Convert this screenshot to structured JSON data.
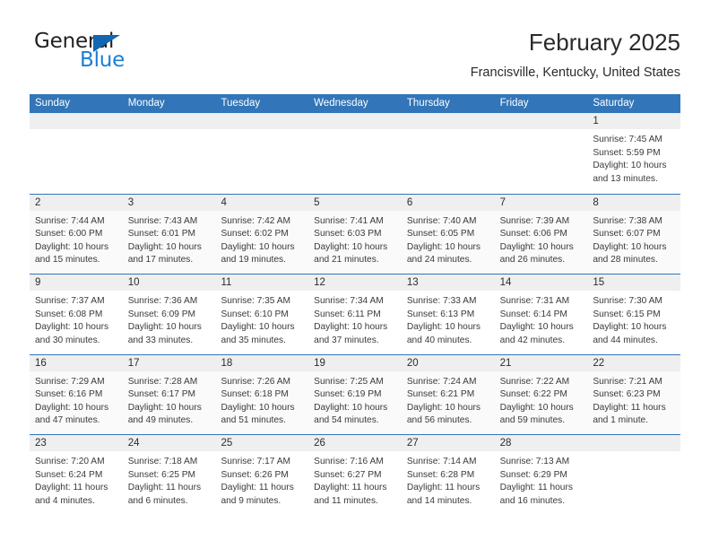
{
  "brand": {
    "name_top": "General",
    "name_bottom": "Blue",
    "accent_color": "#1167b1",
    "blue_text_color": "#1b7fd4"
  },
  "header": {
    "title": "February 2025",
    "subtitle": "Francisville, Kentucky, United States"
  },
  "theme": {
    "header_blue": "#3275b8",
    "day_band_gray": "#efefef",
    "row_shade": "#fafafa"
  },
  "weekdays": [
    "Sunday",
    "Monday",
    "Tuesday",
    "Wednesday",
    "Thursday",
    "Friday",
    "Saturday"
  ],
  "weeks": [
    {
      "shaded": false,
      "days": [
        {
          "number": "",
          "empty": true,
          "sunrise": "",
          "sunset": "",
          "daylight_line1": "",
          "daylight_line2": ""
        },
        {
          "number": "",
          "empty": true,
          "sunrise": "",
          "sunset": "",
          "daylight_line1": "",
          "daylight_line2": ""
        },
        {
          "number": "",
          "empty": true,
          "sunrise": "",
          "sunset": "",
          "daylight_line1": "",
          "daylight_line2": ""
        },
        {
          "number": "",
          "empty": true,
          "sunrise": "",
          "sunset": "",
          "daylight_line1": "",
          "daylight_line2": ""
        },
        {
          "number": "",
          "empty": true,
          "sunrise": "",
          "sunset": "",
          "daylight_line1": "",
          "daylight_line2": ""
        },
        {
          "number": "",
          "empty": true,
          "sunrise": "",
          "sunset": "",
          "daylight_line1": "",
          "daylight_line2": ""
        },
        {
          "number": "1",
          "empty": false,
          "sunrise": "Sunrise: 7:45 AM",
          "sunset": "Sunset: 5:59 PM",
          "daylight_line1": "Daylight: 10 hours",
          "daylight_line2": "and 13 minutes."
        }
      ]
    },
    {
      "shaded": true,
      "days": [
        {
          "number": "2",
          "empty": false,
          "sunrise": "Sunrise: 7:44 AM",
          "sunset": "Sunset: 6:00 PM",
          "daylight_line1": "Daylight: 10 hours",
          "daylight_line2": "and 15 minutes."
        },
        {
          "number": "3",
          "empty": false,
          "sunrise": "Sunrise: 7:43 AM",
          "sunset": "Sunset: 6:01 PM",
          "daylight_line1": "Daylight: 10 hours",
          "daylight_line2": "and 17 minutes."
        },
        {
          "number": "4",
          "empty": false,
          "sunrise": "Sunrise: 7:42 AM",
          "sunset": "Sunset: 6:02 PM",
          "daylight_line1": "Daylight: 10 hours",
          "daylight_line2": "and 19 minutes."
        },
        {
          "number": "5",
          "empty": false,
          "sunrise": "Sunrise: 7:41 AM",
          "sunset": "Sunset: 6:03 PM",
          "daylight_line1": "Daylight: 10 hours",
          "daylight_line2": "and 21 minutes."
        },
        {
          "number": "6",
          "empty": false,
          "sunrise": "Sunrise: 7:40 AM",
          "sunset": "Sunset: 6:05 PM",
          "daylight_line1": "Daylight: 10 hours",
          "daylight_line2": "and 24 minutes."
        },
        {
          "number": "7",
          "empty": false,
          "sunrise": "Sunrise: 7:39 AM",
          "sunset": "Sunset: 6:06 PM",
          "daylight_line1": "Daylight: 10 hours",
          "daylight_line2": "and 26 minutes."
        },
        {
          "number": "8",
          "empty": false,
          "sunrise": "Sunrise: 7:38 AM",
          "sunset": "Sunset: 6:07 PM",
          "daylight_line1": "Daylight: 10 hours",
          "daylight_line2": "and 28 minutes."
        }
      ]
    },
    {
      "shaded": false,
      "days": [
        {
          "number": "9",
          "empty": false,
          "sunrise": "Sunrise: 7:37 AM",
          "sunset": "Sunset: 6:08 PM",
          "daylight_line1": "Daylight: 10 hours",
          "daylight_line2": "and 30 minutes."
        },
        {
          "number": "10",
          "empty": false,
          "sunrise": "Sunrise: 7:36 AM",
          "sunset": "Sunset: 6:09 PM",
          "daylight_line1": "Daylight: 10 hours",
          "daylight_line2": "and 33 minutes."
        },
        {
          "number": "11",
          "empty": false,
          "sunrise": "Sunrise: 7:35 AM",
          "sunset": "Sunset: 6:10 PM",
          "daylight_line1": "Daylight: 10 hours",
          "daylight_line2": "and 35 minutes."
        },
        {
          "number": "12",
          "empty": false,
          "sunrise": "Sunrise: 7:34 AM",
          "sunset": "Sunset: 6:11 PM",
          "daylight_line1": "Daylight: 10 hours",
          "daylight_line2": "and 37 minutes."
        },
        {
          "number": "13",
          "empty": false,
          "sunrise": "Sunrise: 7:33 AM",
          "sunset": "Sunset: 6:13 PM",
          "daylight_line1": "Daylight: 10 hours",
          "daylight_line2": "and 40 minutes."
        },
        {
          "number": "14",
          "empty": false,
          "sunrise": "Sunrise: 7:31 AM",
          "sunset": "Sunset: 6:14 PM",
          "daylight_line1": "Daylight: 10 hours",
          "daylight_line2": "and 42 minutes."
        },
        {
          "number": "15",
          "empty": false,
          "sunrise": "Sunrise: 7:30 AM",
          "sunset": "Sunset: 6:15 PM",
          "daylight_line1": "Daylight: 10 hours",
          "daylight_line2": "and 44 minutes."
        }
      ]
    },
    {
      "shaded": true,
      "days": [
        {
          "number": "16",
          "empty": false,
          "sunrise": "Sunrise: 7:29 AM",
          "sunset": "Sunset: 6:16 PM",
          "daylight_line1": "Daylight: 10 hours",
          "daylight_line2": "and 47 minutes."
        },
        {
          "number": "17",
          "empty": false,
          "sunrise": "Sunrise: 7:28 AM",
          "sunset": "Sunset: 6:17 PM",
          "daylight_line1": "Daylight: 10 hours",
          "daylight_line2": "and 49 minutes."
        },
        {
          "number": "18",
          "empty": false,
          "sunrise": "Sunrise: 7:26 AM",
          "sunset": "Sunset: 6:18 PM",
          "daylight_line1": "Daylight: 10 hours",
          "daylight_line2": "and 51 minutes."
        },
        {
          "number": "19",
          "empty": false,
          "sunrise": "Sunrise: 7:25 AM",
          "sunset": "Sunset: 6:19 PM",
          "daylight_line1": "Daylight: 10 hours",
          "daylight_line2": "and 54 minutes."
        },
        {
          "number": "20",
          "empty": false,
          "sunrise": "Sunrise: 7:24 AM",
          "sunset": "Sunset: 6:21 PM",
          "daylight_line1": "Daylight: 10 hours",
          "daylight_line2": "and 56 minutes."
        },
        {
          "number": "21",
          "empty": false,
          "sunrise": "Sunrise: 7:22 AM",
          "sunset": "Sunset: 6:22 PM",
          "daylight_line1": "Daylight: 10 hours",
          "daylight_line2": "and 59 minutes."
        },
        {
          "number": "22",
          "empty": false,
          "sunrise": "Sunrise: 7:21 AM",
          "sunset": "Sunset: 6:23 PM",
          "daylight_line1": "Daylight: 11 hours",
          "daylight_line2": "and 1 minute."
        }
      ]
    },
    {
      "shaded": false,
      "days": [
        {
          "number": "23",
          "empty": false,
          "sunrise": "Sunrise: 7:20 AM",
          "sunset": "Sunset: 6:24 PM",
          "daylight_line1": "Daylight: 11 hours",
          "daylight_line2": "and 4 minutes."
        },
        {
          "number": "24",
          "empty": false,
          "sunrise": "Sunrise: 7:18 AM",
          "sunset": "Sunset: 6:25 PM",
          "daylight_line1": "Daylight: 11 hours",
          "daylight_line2": "and 6 minutes."
        },
        {
          "number": "25",
          "empty": false,
          "sunrise": "Sunrise: 7:17 AM",
          "sunset": "Sunset: 6:26 PM",
          "daylight_line1": "Daylight: 11 hours",
          "daylight_line2": "and 9 minutes."
        },
        {
          "number": "26",
          "empty": false,
          "sunrise": "Sunrise: 7:16 AM",
          "sunset": "Sunset: 6:27 PM",
          "daylight_line1": "Daylight: 11 hours",
          "daylight_line2": "and 11 minutes."
        },
        {
          "number": "27",
          "empty": false,
          "sunrise": "Sunrise: 7:14 AM",
          "sunset": "Sunset: 6:28 PM",
          "daylight_line1": "Daylight: 11 hours",
          "daylight_line2": "and 14 minutes."
        },
        {
          "number": "28",
          "empty": false,
          "sunrise": "Sunrise: 7:13 AM",
          "sunset": "Sunset: 6:29 PM",
          "daylight_line1": "Daylight: 11 hours",
          "daylight_line2": "and 16 minutes."
        },
        {
          "number": "",
          "empty": true,
          "sunrise": "",
          "sunset": "",
          "daylight_line1": "",
          "daylight_line2": ""
        }
      ]
    }
  ]
}
